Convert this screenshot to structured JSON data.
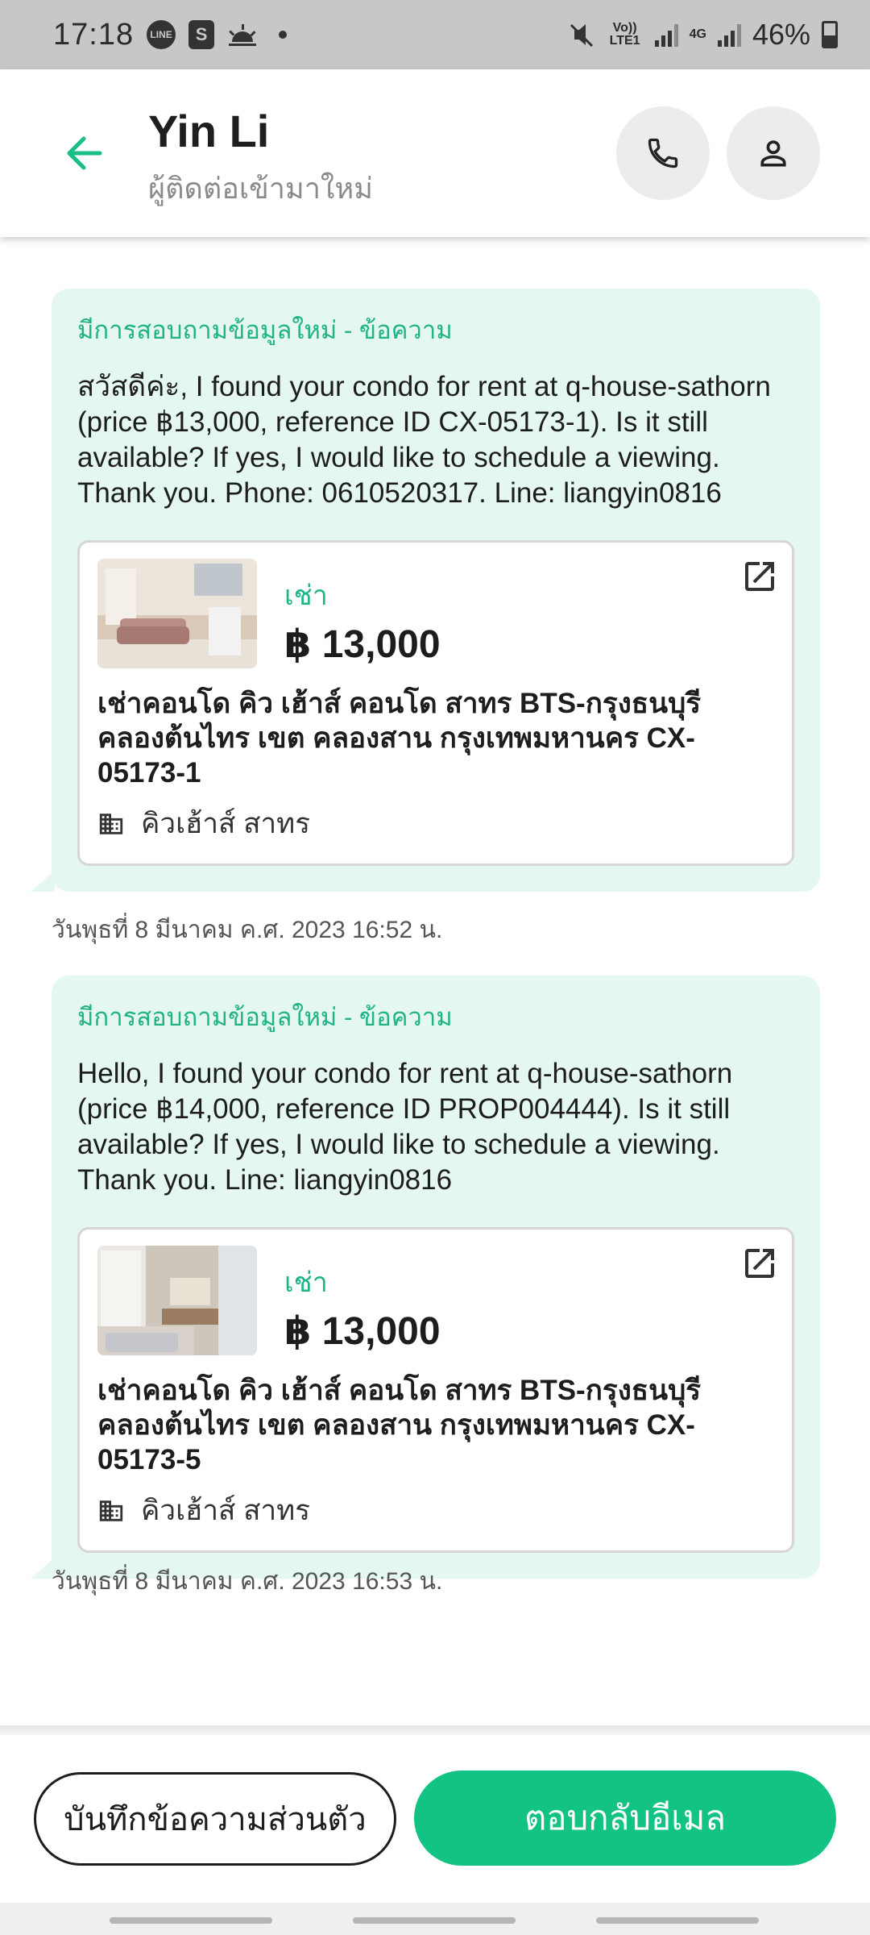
{
  "status_bar": {
    "time": "17:18",
    "line_icon": "LINE",
    "shop_icon": "S",
    "network_volte": "Vo)) LTE1",
    "network_type": "4G",
    "battery": "46%"
  },
  "header": {
    "contact_name": "Yin Li",
    "contact_status": "ผู้ติดต่อเข้ามาใหม่"
  },
  "messages": [
    {
      "label": "มีการสอบถามข้อมูลใหม่ - ข้อความ",
      "text": "สวัสดีค่ะ, I found your condo for rent at q-house-sathorn (price ฿13,000, reference ID CX-05173-1). Is it still available? If yes, I would like to schedule a viewing. Thank you. Phone: 0610520317. Line: liangyin0816",
      "listing": {
        "deal_type": "เช่า",
        "price": "฿ 13,000",
        "title": "เช่าคอนโด คิว เฮ้าส์ คอนโด สาทร BTS-กรุงธนบุรี คลองต้นไทร เขต คลองสาน กรุงเทพมหานคร CX-05173-1",
        "project": "คิวเฮ้าส์ สาทร"
      },
      "timestamp": "วันพุธที่ 8 มีนาคม ค.ศ. 2023 16:52 น."
    },
    {
      "label": "มีการสอบถามข้อมูลใหม่ - ข้อความ",
      "text": "Hello, I found your condo for rent at q-house-sathorn (price ฿14,000, reference ID PROP004444). Is it still available? If yes, I would like to schedule a viewing. Thank you. Line: liangyin0816",
      "listing": {
        "deal_type": "เช่า",
        "price": "฿ 13,000",
        "title": "เช่าคอนโด คิว เฮ้าส์ คอนโด สาทร BTS-กรุงธนบุรี คลองต้นไทร เขต คลองสาน กรุงเทพมหานคร CX-05173-5",
        "project": "คิวเฮ้าส์ สาทร"
      },
      "timestamp": "วันพุธที่ 8 มีนาคม ค.ศ. 2023 16:53 น."
    }
  ],
  "actions": {
    "private_note": "บันทึกข้อความส่วนตัว",
    "reply_email": "ตอบกลับอีเมล"
  },
  "colors": {
    "accent": "#13c383",
    "accent_text": "#1fb386",
    "bubble_bg": "#e4f7f0"
  }
}
